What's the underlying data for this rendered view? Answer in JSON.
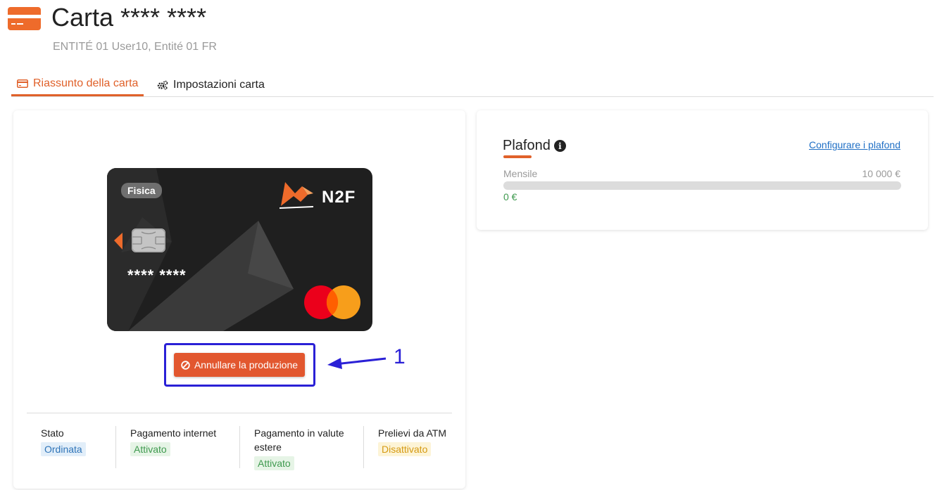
{
  "header": {
    "title": "Carta **** ****",
    "subtitle": "ENTITÉ 01 User10, Entité 01 FR",
    "icon": "credit-card-icon"
  },
  "tabs": [
    {
      "label": "Riassunto della carta",
      "icon": "credit-card-icon",
      "active": true
    },
    {
      "label": "Impostazioni carta",
      "icon": "gears-icon",
      "active": false
    }
  ],
  "card": {
    "type_badge": "Fisica",
    "number": "**** ****",
    "brand": "N2F",
    "network": "mastercard-logo"
  },
  "actions": {
    "cancel_label": "Annullare la produzione",
    "cancel_icon": "ban-icon",
    "annotation_number": "1"
  },
  "status": [
    {
      "label": "Stato",
      "value": "Ordinata",
      "color": "blue"
    },
    {
      "label": "Pagamento internet",
      "value": "Attivato",
      "color": "green"
    },
    {
      "label": "Pagamento in valute estere",
      "value": "Attivato",
      "color": "green"
    },
    {
      "label": "Prelievi da ATM",
      "value": "Disattivato",
      "color": "yellow"
    }
  ],
  "limits": {
    "title": "Plafond",
    "configure_label": "Configurare i plafond",
    "period_label": "Mensile",
    "limit_amount": "10 000 €",
    "spent_amount": "0 €",
    "spent_fraction": 0
  },
  "colors": {
    "accent": "#e0612a",
    "cancel_button": "#e2572f",
    "annotation": "#2a20d6",
    "link": "#1f6fc5"
  }
}
